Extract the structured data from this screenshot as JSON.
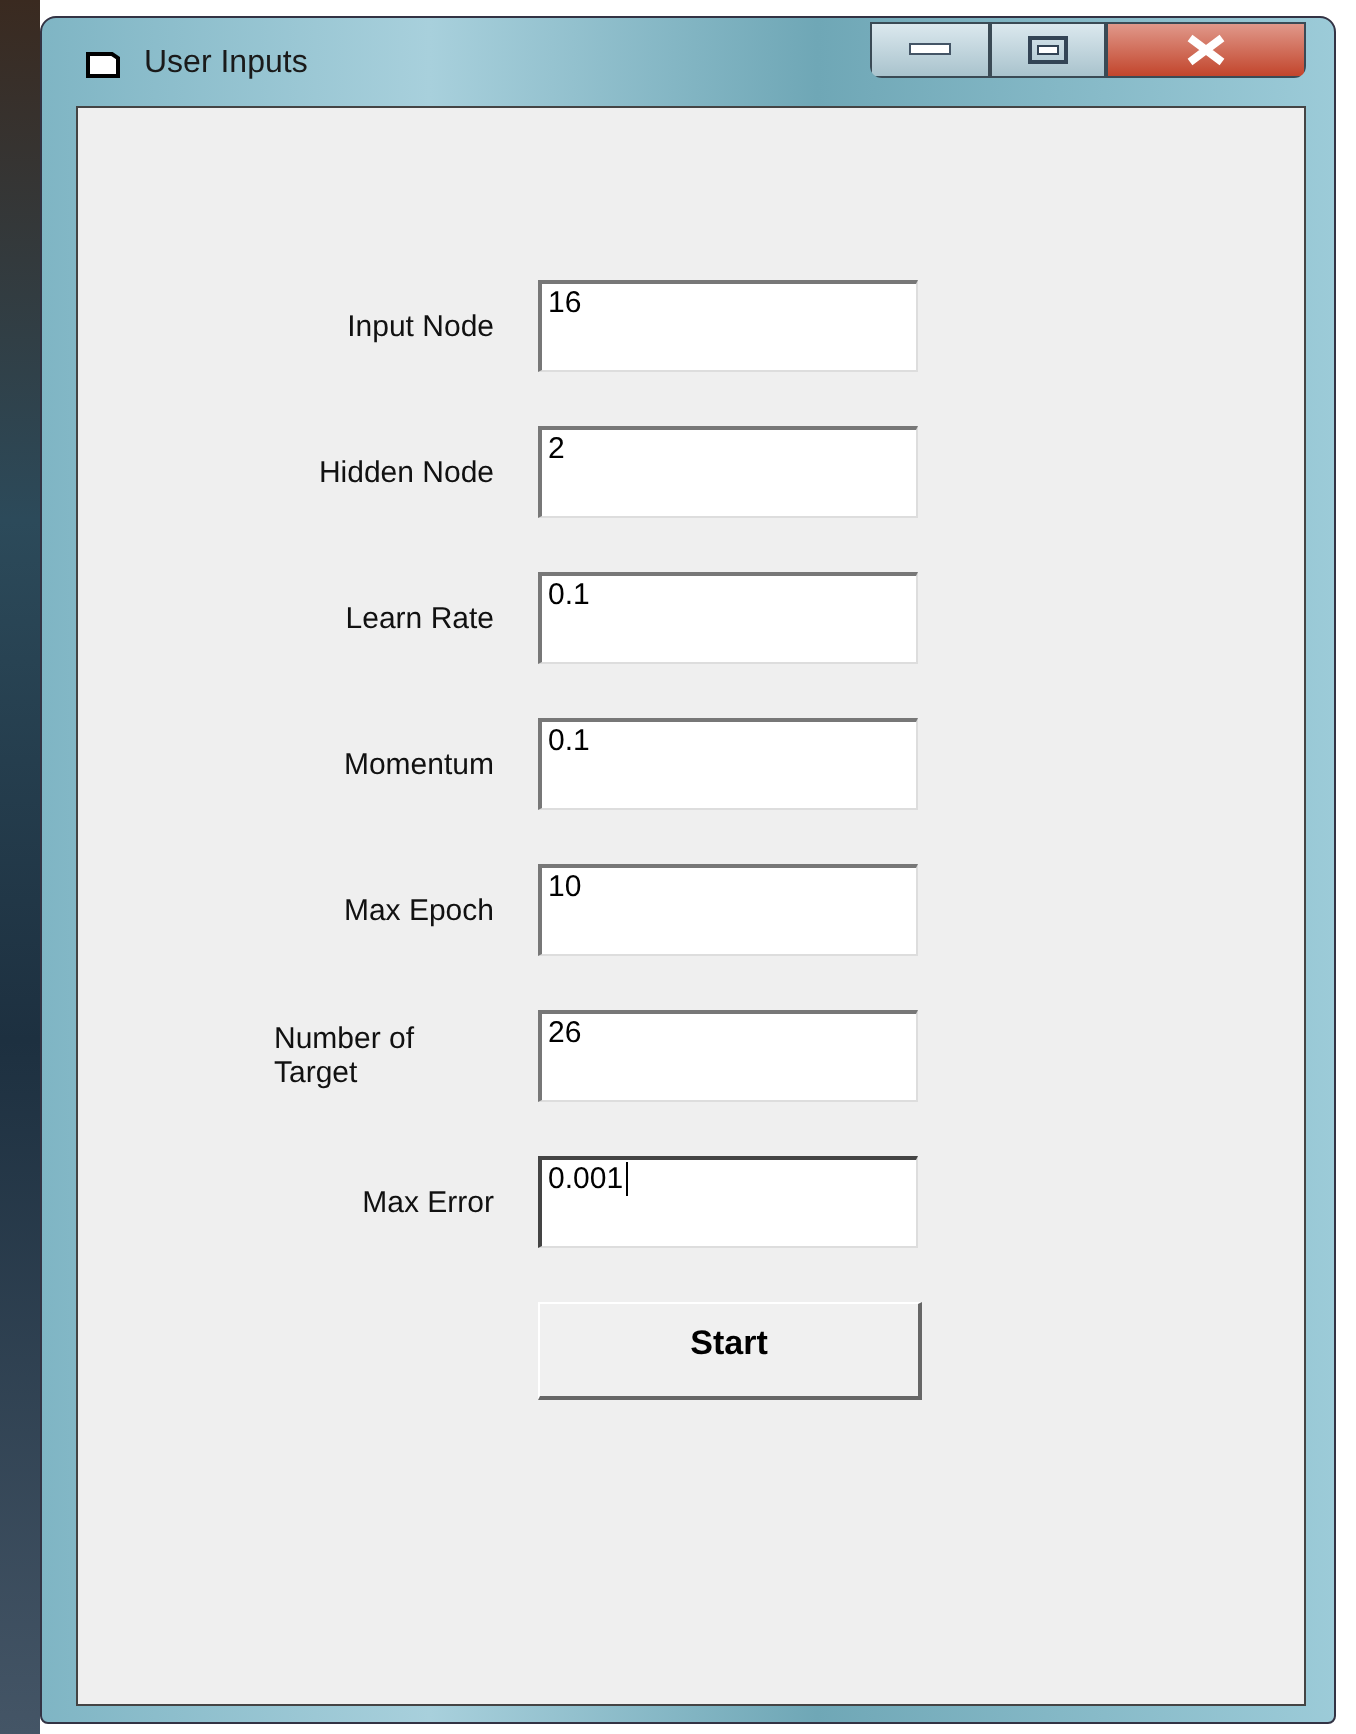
{
  "window": {
    "title": "User Inputs"
  },
  "fields": [
    {
      "label": "Input Node",
      "value": "16",
      "focused": false
    },
    {
      "label": "Hidden Node",
      "value": "2",
      "focused": false
    },
    {
      "label": "Learn Rate",
      "value": "0.1",
      "focused": false
    },
    {
      "label": "Momentum",
      "value": "0.1",
      "focused": false
    },
    {
      "label": "Max Epoch",
      "value": "10",
      "focused": false
    },
    {
      "label": "Number of Target",
      "value": "26",
      "focused": false
    },
    {
      "label": "Max Error",
      "value": "0.001",
      "focused": true
    }
  ],
  "buttons": [
    "Start"
  ]
}
